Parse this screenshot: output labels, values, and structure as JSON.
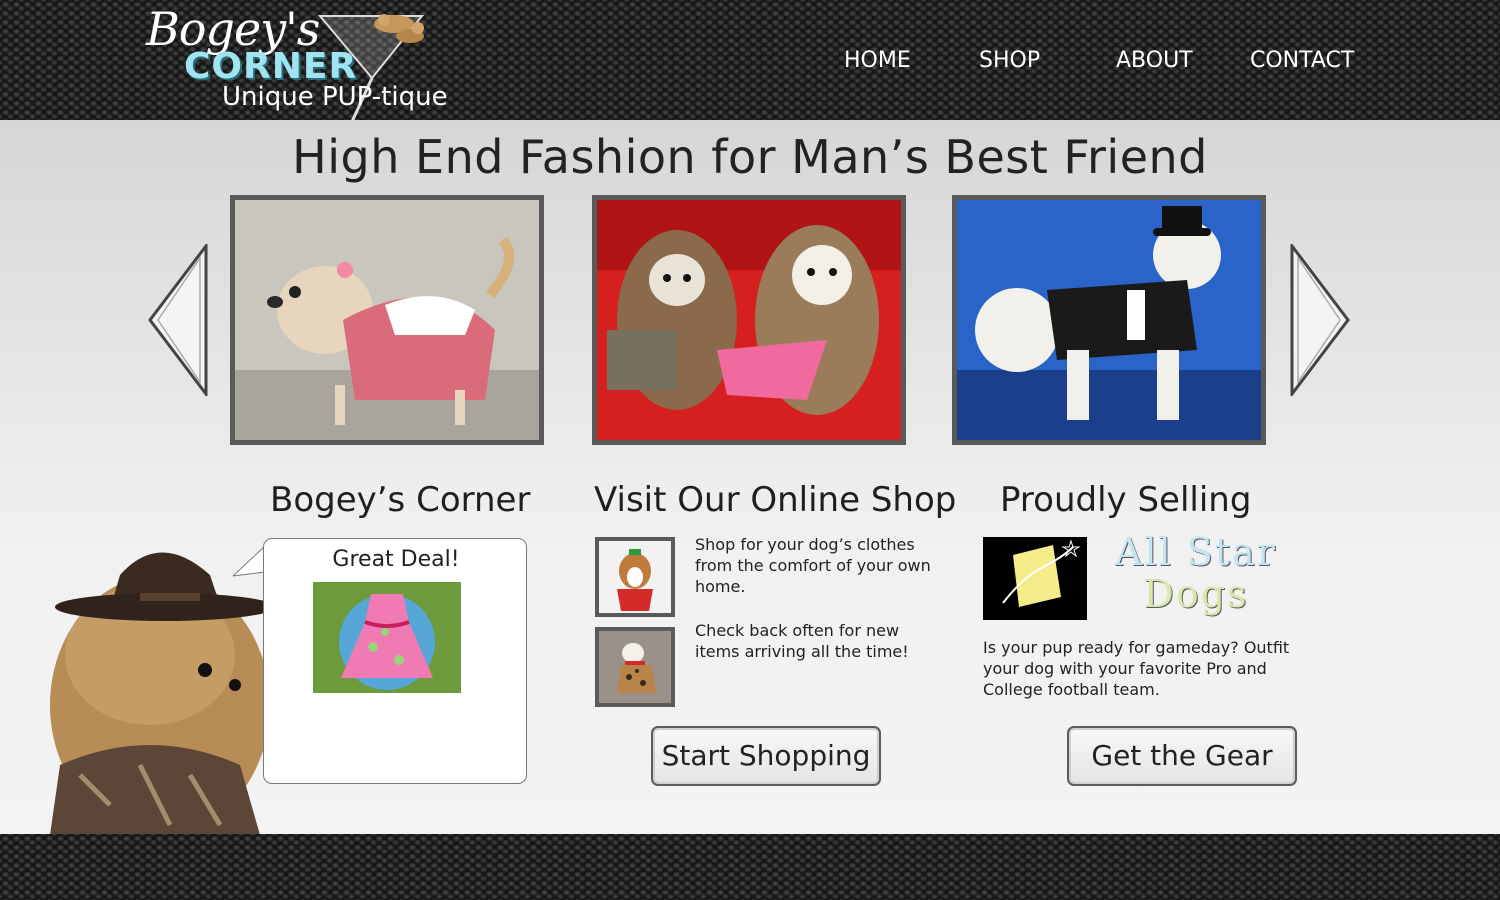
{
  "brand": {
    "script": "Bogey's",
    "name": "CORNER",
    "tagline": "Unique PUP-tique"
  },
  "nav": {
    "items": [
      {
        "label": "HOME"
      },
      {
        "label": "SHOP"
      },
      {
        "label": "ABOUT"
      },
      {
        "label": "CONTACT"
      }
    ]
  },
  "hero": {
    "title": "High End Fashion for Man’s Best Friend",
    "slides": [
      {
        "subject": "dog in red gingham dress"
      },
      {
        "subject": "two shih tzus in outfits"
      },
      {
        "subject": "poodle in tuxedo and top hat"
      }
    ],
    "prev_icon": "triangle-left-icon",
    "next_icon": "triangle-right-icon"
  },
  "about": {
    "heading": "Bogey’s Corner",
    "bubble_title": "Great Deal!"
  },
  "shop": {
    "heading": "Visit Our Online Shop",
    "text_1": "Shop for your dog’s clothes from the comfort of your own home.",
    "text_2": "Check back often for new items arriving all the time!",
    "button": "Start Shopping"
  },
  "selling": {
    "heading": "Proudly Selling",
    "partner_line1": "All Star",
    "partner_line2": "Dogs",
    "text": "Is your pup ready for gameday? Outfit your dog with your favorite Pro and College football team.",
    "button": "Get the Gear"
  },
  "colors": {
    "header_bg": "#1e1e1e",
    "brand_accent": "#9fe4f0",
    "body_bg": "#e6e6e6",
    "frame": "#5a5a5a"
  }
}
